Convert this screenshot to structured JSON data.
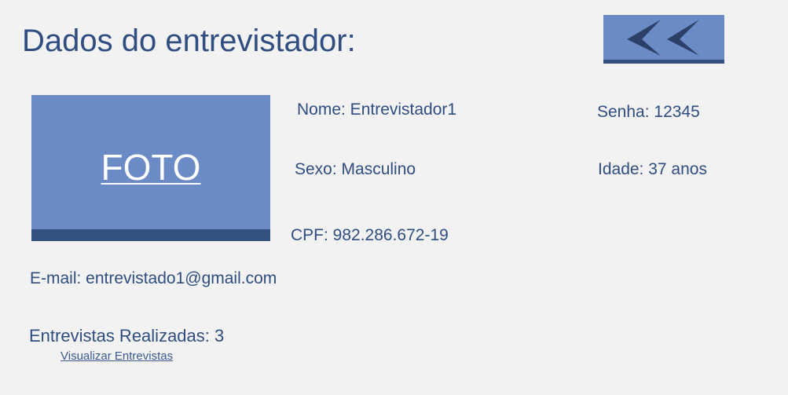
{
  "header": {
    "title": "Dados do entrevistador:"
  },
  "back_button": {
    "icon": "double-chevron-left-icon"
  },
  "photo": {
    "label": "FOTO"
  },
  "profile": {
    "name": "Nome: Entrevistador1",
    "password": "Senha: 12345",
    "sex": "Sexo: Masculino",
    "age": "Idade: 37 anos",
    "cpf": "CPF: 982.286.672-19",
    "email": "E-mail: entrevistado1@gmail.com"
  },
  "interviews": {
    "count_text": "Entrevistas Realizadas: 3",
    "view_link": "Visualizar Entrevistas"
  },
  "colors": {
    "background": "#f2f2f2",
    "accent": "#6a8bc6",
    "accent_dark": "#33527f",
    "text": "#2f4d80"
  }
}
